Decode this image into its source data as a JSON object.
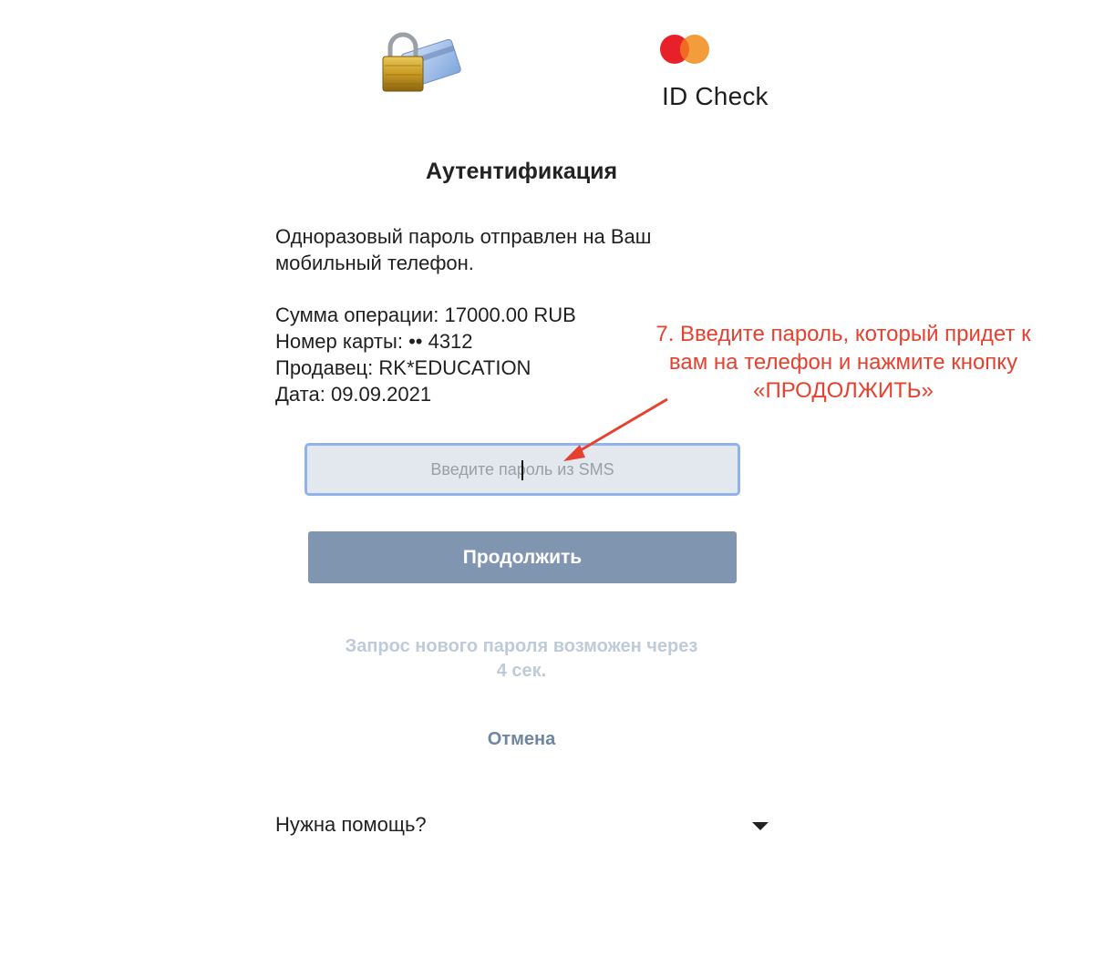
{
  "header": {
    "bank_logo_icon": "padlock-card-icon",
    "brand_logo_icon": "mastercard-icon",
    "brand_colors": {
      "left_circle": "#e8202a",
      "right_circle": "#f39c3c",
      "overlap": "#f16a21"
    },
    "brand_label": "ID Check"
  },
  "main": {
    "title": "Аутентификация",
    "message_line1": "Одноразовый пароль отправлен на Ваш",
    "message_line2": "мобильный телефон.",
    "details": [
      {
        "label": "Сумма операции:",
        "value": "17000.00 RUB"
      },
      {
        "label": "Номер карты:",
        "value": "•• 4312"
      },
      {
        "label": "Продавец:",
        "value": "RK*EDUCATION"
      },
      {
        "label": "Дата:",
        "value": "09.09.2021"
      }
    ]
  },
  "form": {
    "otp_placeholder": "Введите пароль из SMS",
    "otp_value": "",
    "continue_label": "Продолжить",
    "resend_line1": "Запрос нового пароля возможен через",
    "resend_line2": "4 сек.",
    "cancel_label": "Отмена"
  },
  "help": {
    "label": "Нужна помощь?",
    "expand_icon": "caret-down-icon"
  },
  "annotation": {
    "line1": "7. Введите пароль, который придет к",
    "line2": "вам на телефон и нажмите кнопку",
    "line3": "«ПРОДОЛЖИТЬ»",
    "color": "#e8402f"
  },
  "colors": {
    "button_bg": "#8095b0",
    "input_border": "#8fb3ea",
    "input_bg": "#e3e8ef",
    "resend_text": "#bfcbd9",
    "cancel_text": "#6f86a3"
  }
}
